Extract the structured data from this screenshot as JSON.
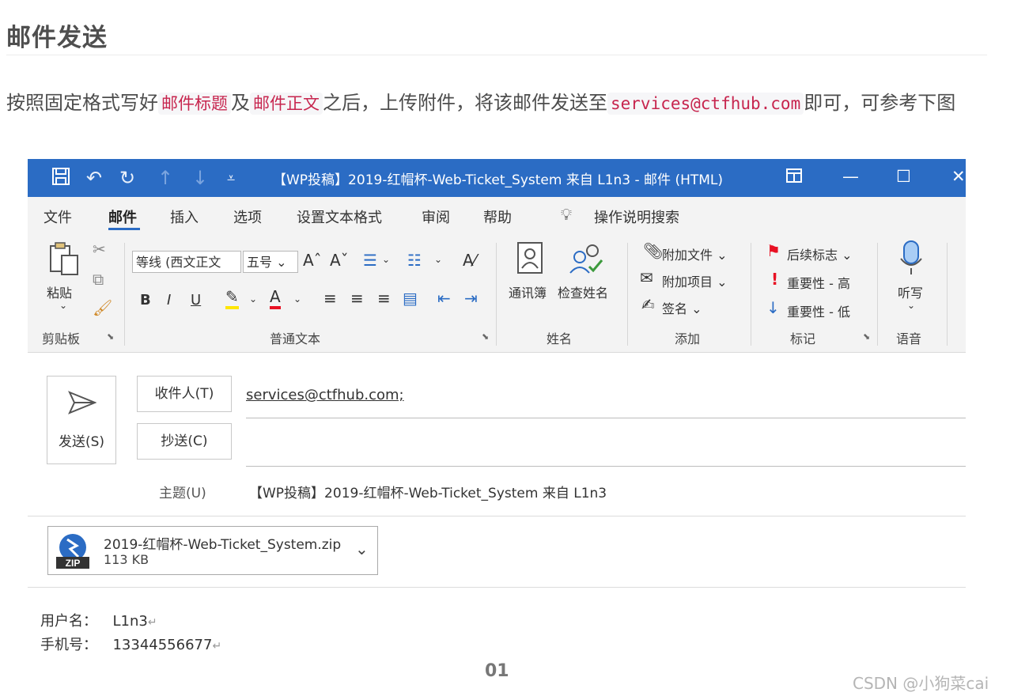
{
  "heading": "邮件发送",
  "paragraph": {
    "part1": "按照固定格式写好",
    "code1": "邮件标题",
    "part2": "及",
    "code2": "邮件正文",
    "part3": "之后，上传附件，将该邮件发送至",
    "code3": "services@ctfhub.com",
    "part4": "即可，可参考下图"
  },
  "outlook": {
    "window_title": "【WP投稿】2019-红帽杯-Web-Ticket_System 来自 L1n3  -  邮件 (HTML)",
    "quick_access_icons": [
      "save-icon",
      "undo-icon",
      "redo-icon",
      "up-arrow-icon",
      "down-arrow-icon",
      "customize-icon"
    ],
    "window_controls": [
      "restore-ribbon-icon",
      "minimize-icon",
      "maximize-icon",
      "close-icon"
    ],
    "menu": [
      "文件",
      "邮件",
      "插入",
      "选项",
      "设置文本格式",
      "审阅",
      "帮助"
    ],
    "active_menu": "邮件",
    "tell_me": "操作说明搜索",
    "ribbon": {
      "clipboard": {
        "paste": "粘贴",
        "label": "剪贴板"
      },
      "basic_text": {
        "font": "等线 (西文正文",
        "size": "五号",
        "bold": "B",
        "italic": "I",
        "underline": "U",
        "label": "普通文本"
      },
      "names": {
        "address_book": "通讯簿",
        "check_names": "检查姓名",
        "label": "姓名"
      },
      "include": {
        "attach_file": "附加文件",
        "attach_item": "附加项目",
        "signature": "签名",
        "label": "添加"
      },
      "tags": {
        "follow_up": "后续标志",
        "high": "重要性 - 高",
        "low": "重要性 - 低",
        "label": "标记"
      },
      "voice": {
        "dictate": "听写",
        "label": "语音"
      }
    },
    "compose": {
      "send_label": "发送(S)",
      "to_label": "收件人(T)",
      "cc_label": "抄送(C)",
      "to_value": "services@ctfhub.com;",
      "subject_label": "主题(U)",
      "subject_value": "【WP投稿】2019-红帽杯-Web-Ticket_System 来自 L1n3",
      "attachment": {
        "name": "2019-红帽杯-Web-Ticket_System.zip",
        "size": "113 KB",
        "badge": "ZIP"
      },
      "body": [
        {
          "label": "用户名：",
          "value": "L1n3"
        },
        {
          "label": "手机号：",
          "value": "13344556677"
        }
      ]
    }
  },
  "caption": "01",
  "watermark": "CSDN @小狗菜cai",
  "colors": {
    "accent": "#2b6cc4",
    "code_text": "#c7254e"
  }
}
